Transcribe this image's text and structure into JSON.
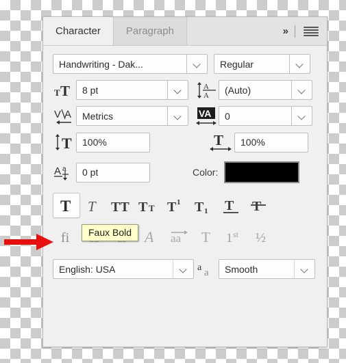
{
  "panel": {
    "tabs": [
      {
        "label": "Character",
        "active": true
      },
      {
        "label": "Paragraph",
        "active": false
      }
    ],
    "collapse_icon": "double-chevron-right-icon",
    "menu_icon": "panel-menu-icon"
  },
  "font": {
    "family_value": "Handwriting - Dak...",
    "style_value": "Regular"
  },
  "size": {
    "icon": "font-size-icon",
    "value": "8 pt",
    "leading_icon": "leading-icon",
    "leading_value": "(Auto)"
  },
  "spacing": {
    "kerning_icon": "kerning-icon",
    "kerning_value": "Metrics",
    "tracking_icon": "tracking-icon",
    "tracking_value": "0"
  },
  "scale": {
    "vertical_icon": "vertical-scale-icon",
    "vertical_value": "100%",
    "horizontal_icon": "horizontal-scale-icon",
    "horizontal_value": "100%"
  },
  "baseline": {
    "icon": "baseline-shift-icon",
    "value": "0 pt",
    "color_label": "Color:",
    "color_value": "#000000"
  },
  "styles": [
    {
      "name": "faux-bold-button",
      "glyph": "T",
      "active": true
    },
    {
      "name": "faux-italic-button",
      "glyph": "T",
      "active": false
    },
    {
      "name": "all-caps-button",
      "glyph": "TT",
      "active": false
    },
    {
      "name": "small-caps-button",
      "glyph": "Tr",
      "active": false
    },
    {
      "name": "superscript-button",
      "glyph": "T1",
      "active": false
    },
    {
      "name": "subscript-button",
      "glyph": "T1",
      "active": false
    },
    {
      "name": "underline-button",
      "glyph": "T",
      "active": false
    },
    {
      "name": "strikethrough-button",
      "glyph": "T",
      "active": false
    }
  ],
  "opentype": [
    {
      "name": "standard-ligatures-button",
      "glyph": "fi"
    },
    {
      "name": "contextual-alternates-button",
      "glyph": "ca"
    },
    {
      "name": "discretionary-ligatures-button",
      "glyph": "dl"
    },
    {
      "name": "swash-button",
      "glyph": "A"
    },
    {
      "name": "oldstyle-button",
      "glyph": "aa"
    },
    {
      "name": "titling-alternates-button",
      "glyph": "T"
    },
    {
      "name": "ordinals-button",
      "glyph": "1st"
    },
    {
      "name": "fractions-button",
      "glyph": "1/2"
    }
  ],
  "tooltip": {
    "text": "Faux Bold"
  },
  "bottom": {
    "language_value": "English: USA",
    "aa_icon": "anti-alias-icon",
    "antialias_value": "Smooth"
  },
  "annotation": {
    "arrow": "red-pointer-arrow",
    "color": "#e8100f"
  }
}
